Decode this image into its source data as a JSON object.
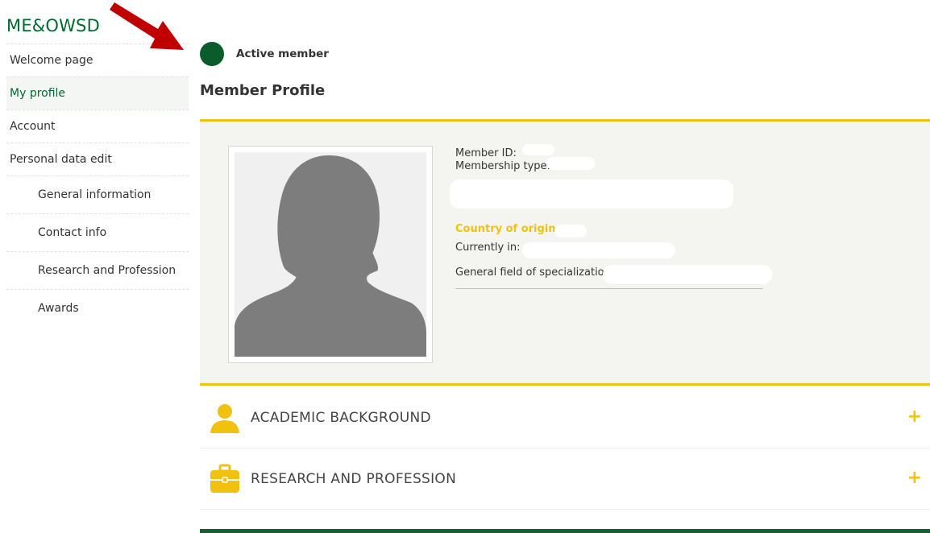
{
  "sidebar": {
    "brand": "ME&OWSD",
    "items": [
      {
        "label": "Welcome page"
      },
      {
        "label": "My profile"
      },
      {
        "label": "Account"
      },
      {
        "label": "Personal data edit"
      },
      {
        "label": "General information"
      },
      {
        "label": "Contact info"
      },
      {
        "label": "Research and Profession"
      },
      {
        "label": "Awards"
      }
    ]
  },
  "status": {
    "label": "Active member",
    "color": "#0b5c2b"
  },
  "page": {
    "title": "Member Profile"
  },
  "profile": {
    "member_id_label": "Member ID:",
    "membership_type_label": "Membership type:",
    "country_label": "Country of origin:",
    "currently_in_label": "Currently in:",
    "field_label": "General field of specialization:"
  },
  "sections": [
    {
      "label": "ACADEMIC BACKGROUND",
      "icon": "person-icon"
    },
    {
      "label": "RESEARCH AND PROFESSION",
      "icon": "briefcase-icon"
    }
  ],
  "colors": {
    "accent": "#f0c20f",
    "brand": "#006b2e",
    "annotation_arrow": "#c00000"
  }
}
